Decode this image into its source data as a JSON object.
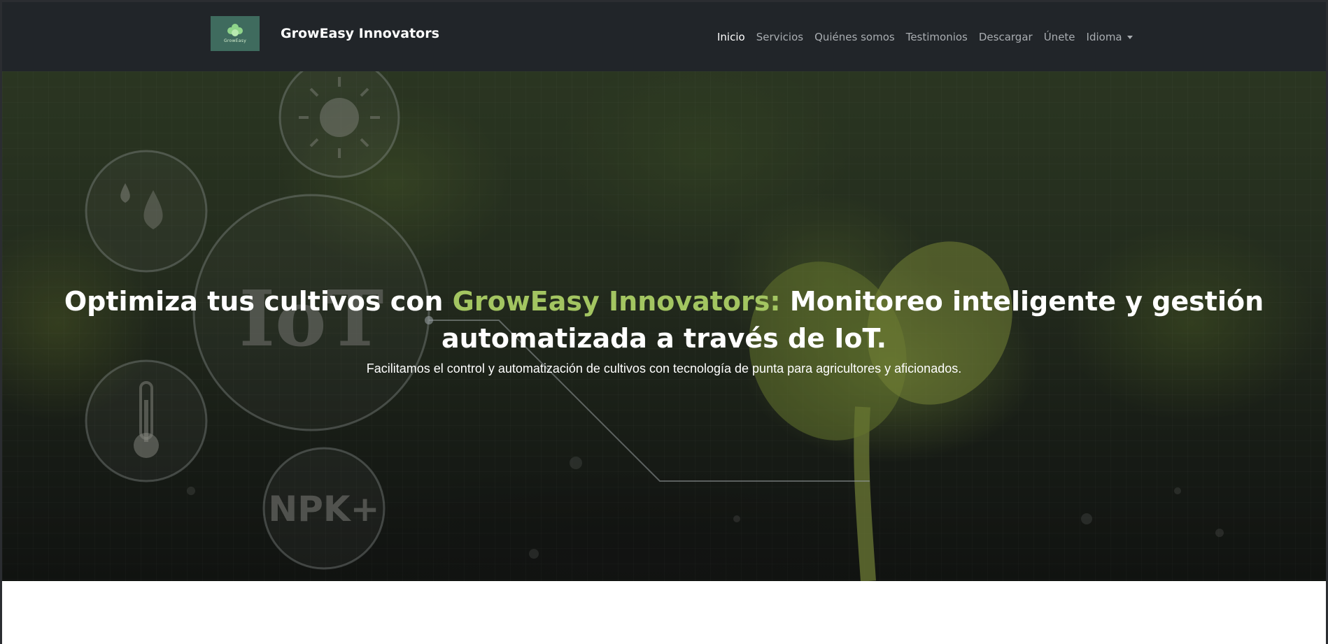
{
  "brand": {
    "logo_text": "GrowEasy",
    "name": "GrowEasy Innovators"
  },
  "nav": {
    "items": [
      {
        "label": "Inicio",
        "active": true
      },
      {
        "label": "Servicios",
        "active": false
      },
      {
        "label": "Quiénes somos",
        "active": false
      },
      {
        "label": "Testimonios",
        "active": false
      },
      {
        "label": "Descargar",
        "active": false
      },
      {
        "label": "Únete",
        "active": false
      },
      {
        "label": "Idioma",
        "active": false,
        "dropdown": true
      }
    ]
  },
  "hero": {
    "headline_pre": "Optimiza tus cultivos con ",
    "headline_accent": "GrowEasy Innovators:",
    "headline_post": " Monitoreo inteligente y gestión automatizada a través de IoT.",
    "subtitle": "Facilitamos el control y automatización de cultivos con tecnología de punta para agricultores y aficionados.",
    "icons": {
      "iot": "IoT",
      "npk": "NPK+"
    }
  },
  "colors": {
    "navbar": "#212529",
    "accent": "#a3c561",
    "logo_bg": "#3f6b5e"
  }
}
